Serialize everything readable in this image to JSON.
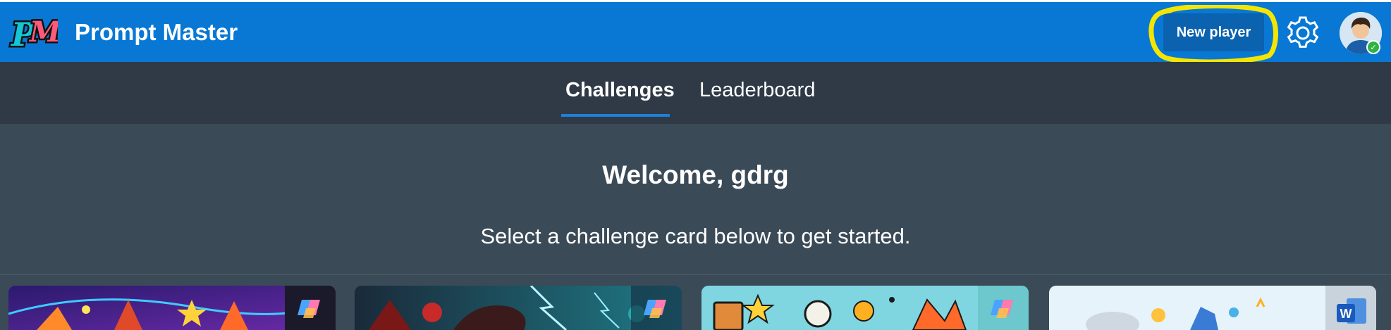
{
  "header": {
    "app_title": "Prompt Master",
    "logo_text": "PM",
    "new_player_label": "New player",
    "settings_icon": "gear-icon",
    "highlight_color": "#f5e600",
    "brand_color": "#0878d4"
  },
  "nav": {
    "tabs": [
      {
        "label": "Challenges",
        "active": true
      },
      {
        "label": "Leaderboard",
        "active": false
      }
    ]
  },
  "main": {
    "welcome": "Welcome, gdrg",
    "subtitle": "Select a challenge card below to get started."
  },
  "cards": [
    {
      "badge_icon": "copilot-icon"
    },
    {
      "badge_icon": "copilot-icon"
    },
    {
      "badge_icon": "copilot-icon"
    },
    {
      "badge_icon": "word-icon",
      "badge_text": "W"
    }
  ]
}
